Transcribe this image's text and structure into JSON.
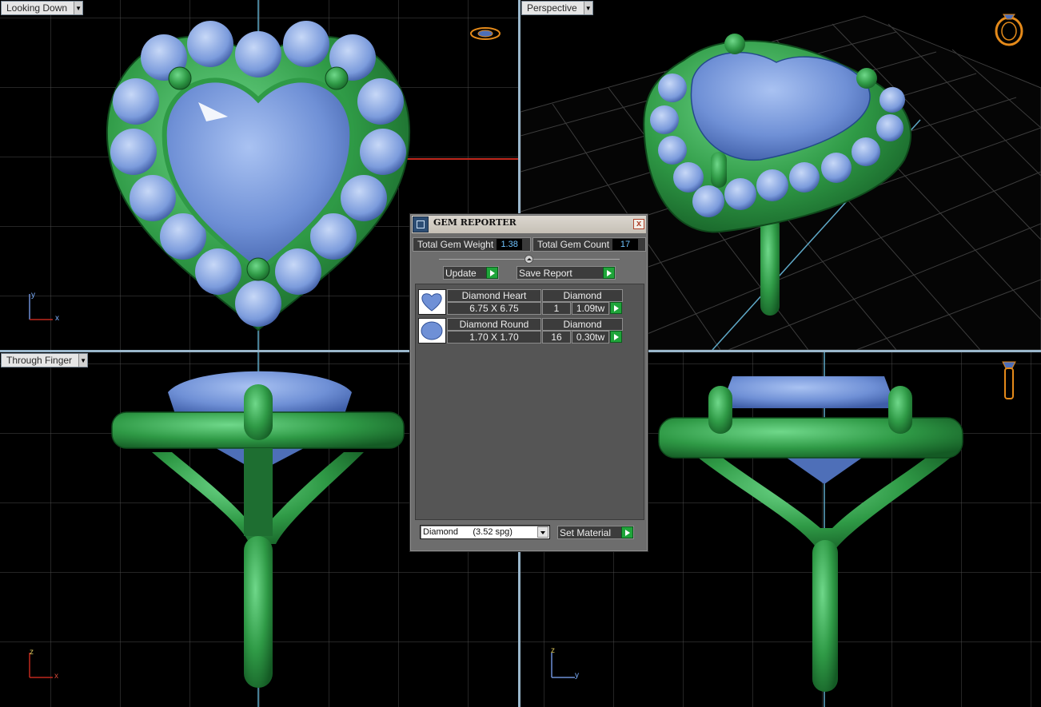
{
  "viewports": {
    "top_left": {
      "label": "Looking Down"
    },
    "top_right": {
      "label": "Perspective"
    },
    "bottom_left": {
      "label": "Through Finger"
    },
    "bottom_right": {
      "label": ""
    }
  },
  "axes": {
    "top_left": {
      "vertical": "y",
      "horizontal": "x"
    },
    "bottom_left": {
      "vertical": "z",
      "horizontal": "x"
    },
    "bottom_right": {
      "vertical": "z",
      "horizontal": "y"
    }
  },
  "icons": {
    "top_left": "ring-top-view-icon",
    "top_right": "ring-perspective-icon",
    "bottom_left": "ring-side-view-icon"
  },
  "colors": {
    "metal": "#2f9a46",
    "gem": "#6f90d6",
    "grid": "#4a4a4a",
    "viewport_divider": "#9ab7cc",
    "value_text": "#6fc3ff",
    "go_button": "#1fa53a"
  },
  "gem_reporter": {
    "title": "GEM REPORTER",
    "close": "x",
    "total_weight_label": "Total Gem Weight",
    "total_weight_value": "1.38",
    "total_count_label": "Total Gem Count",
    "total_count_value": "17",
    "update_label": "Update",
    "save_report_label": "Save Report",
    "gems": [
      {
        "name": "Diamond Heart",
        "material": "Diamond",
        "size": "6.75 X 6.75",
        "count": "1",
        "weight": "1.09tw"
      },
      {
        "name": "Diamond Round",
        "material": "Diamond",
        "size": "1.70 X 1.70",
        "count": "16",
        "weight": "0.30tw"
      }
    ],
    "material_select": "Diamond      (3.52 spg)",
    "set_material_label": "Set Material"
  }
}
